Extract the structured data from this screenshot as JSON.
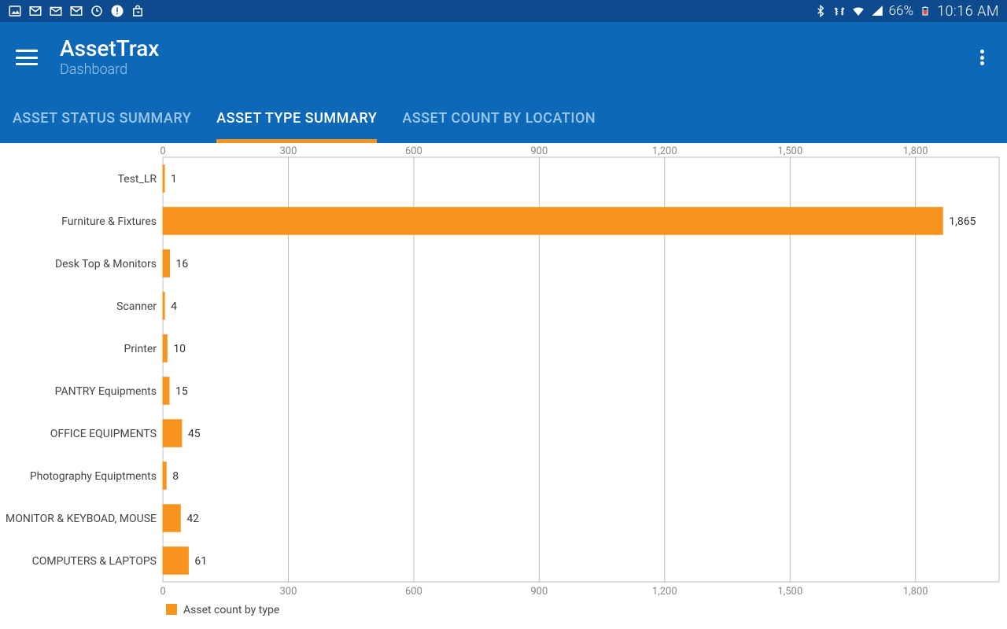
{
  "status_bar": {
    "battery_pct": "66%",
    "time": "10:16 AM"
  },
  "app": {
    "title": "AssetTrax",
    "subtitle": "Dashboard"
  },
  "tabs": [
    {
      "label": "ASSET STATUS SUMMARY",
      "active": false
    },
    {
      "label": "ASSET TYPE SUMMARY",
      "active": true
    },
    {
      "label": "ASSET COUNT BY LOCATION",
      "active": false
    }
  ],
  "legend_label": "Asset count by type",
  "colors": {
    "brand_dark": "#0d4b8e",
    "brand": "#0d68b7",
    "accent": "#f7941e"
  },
  "chart_data": {
    "type": "bar",
    "orientation": "horizontal",
    "categories": [
      "Test_LR",
      "Furniture & Fixtures",
      "Desk Top & Monitors",
      "Scanner",
      "Printer",
      "PANTRY Equipments",
      "OFFICE EQUIPMENTS",
      "Photography Equiptments",
      "MONITOR & KEYBOAD, MOUSE",
      "COMPUTERS & LAPTOPS"
    ],
    "values": [
      1,
      1865,
      16,
      4,
      10,
      15,
      45,
      8,
      42,
      61
    ],
    "value_labels": [
      "1",
      "1,865",
      "16",
      "4",
      "10",
      "15",
      "45",
      "8",
      "42",
      "61"
    ],
    "xticks": [
      0,
      300,
      600,
      900,
      1200,
      1500,
      1800
    ],
    "xtick_labels": [
      "0",
      "300",
      "600",
      "900",
      "1,200",
      "1,500",
      "1,800"
    ],
    "xlim": [
      0,
      2000
    ],
    "series_name": "Asset count by type"
  }
}
